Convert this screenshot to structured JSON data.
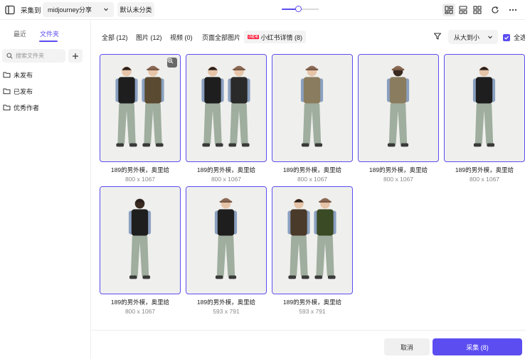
{
  "toolbar": {
    "collect_label": "采集到",
    "album": "midjourney分享",
    "default_uncategorized": "默认未分类",
    "zoom_level": 0.45
  },
  "sidebar": {
    "tabs": [
      {
        "label": "最近",
        "active": false
      },
      {
        "label": "文件夹",
        "active": true
      }
    ],
    "search_placeholder": "搜索文件夹",
    "folders": [
      {
        "label": "未发布",
        "icon": "folder-icon"
      },
      {
        "label": "已发布",
        "icon": "folder-icon"
      },
      {
        "label": "优秀作者",
        "icon": "folder-icon"
      }
    ]
  },
  "filters": {
    "tabs": [
      {
        "label": "全部 (12)"
      },
      {
        "label": "图片 (12)"
      },
      {
        "label": "视频 (0)"
      },
      {
        "label": "页面全部图片"
      },
      {
        "label": "小红书详情 (8)",
        "badge": "小红书"
      }
    ],
    "sort": "从大到小",
    "select_all": "全选",
    "select_all_checked": true
  },
  "images": [
    {
      "title": "189的男外模，奥里给",
      "size": "800 x 1067",
      "selected": true
    },
    {
      "title": "189的男外模，奥里给",
      "size": "800 x 1067",
      "selected": true
    },
    {
      "title": "189的男外模，奥里给",
      "size": "800 x 1067",
      "selected": true
    },
    {
      "title": "189的男外模，奥里给",
      "size": "800 x 1067",
      "selected": true
    },
    {
      "title": "189的男外模，奥里给",
      "size": "800 x 1067",
      "selected": true
    },
    {
      "title": "189的男外模，奥里给",
      "size": "800 x 1067",
      "selected": true
    },
    {
      "title": "189的男外模，奥里给",
      "size": "593 x 791",
      "selected": true
    },
    {
      "title": "189的男外模，奥里给",
      "size": "593 x 791",
      "selected": true
    }
  ],
  "footer": {
    "cancel_label": "取消",
    "collect_label": "采集 (8)"
  },
  "colors": {
    "accent": "#5b4df0",
    "xiaohongshu": "#ff2442"
  }
}
